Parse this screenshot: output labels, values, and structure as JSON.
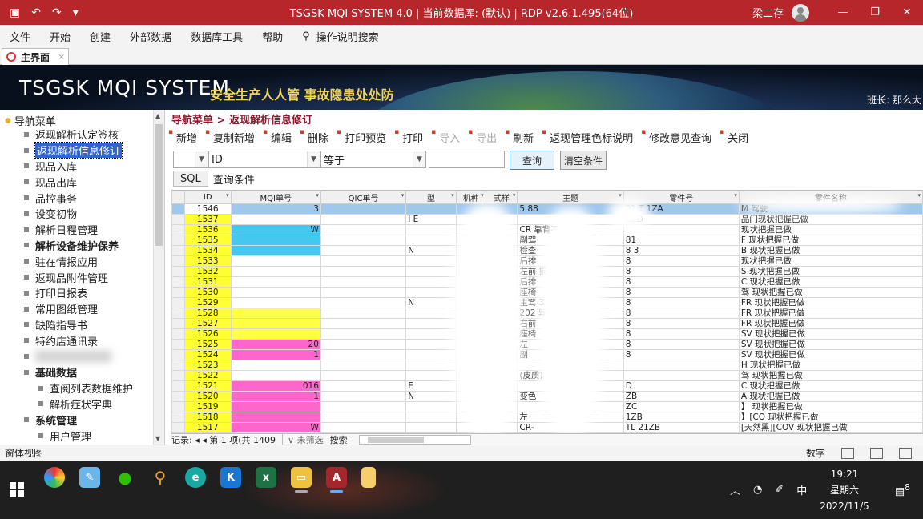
{
  "titlebar": {
    "title": "TSGSK MQI SYSTEM 4.0 | 当前数据库: (默认) | RDP v2.6.1.495(64位)",
    "user": "梁二存",
    "minimize": "—",
    "restore": "❐",
    "close": "✕"
  },
  "menu": {
    "items": [
      "文件",
      "开始",
      "创建",
      "外部数据",
      "数据库工具",
      "帮助"
    ],
    "search_label": "操作说明搜索"
  },
  "doc_tab": {
    "label": "主界面",
    "close": "×"
  },
  "banner": {
    "system_name": "TSGSK MQI SYSTEM",
    "slogan": "安全生产人人管 事故隐患处处防",
    "leader": "班长: 那么大"
  },
  "nav": {
    "title": "导航菜单",
    "items": [
      {
        "label": "返现解析认定签核"
      },
      {
        "label": "返现解析信息修订",
        "selected": true
      },
      {
        "label": "现品入库"
      },
      {
        "label": "现品出库"
      },
      {
        "label": "品控事务"
      },
      {
        "label": "设变初物"
      },
      {
        "label": "解析日程管理"
      },
      {
        "label": "解析设备维护保养",
        "bold": true
      },
      {
        "label": "驻在情报应用"
      },
      {
        "label": "返现品附件管理"
      },
      {
        "label": "打印日报表"
      },
      {
        "label": "常用图纸管理"
      },
      {
        "label": "缺陷指导书"
      },
      {
        "label": "特约店通讯录"
      },
      {
        "label": "",
        "blurred": true
      },
      {
        "label": "基础数据",
        "bold": true
      },
      {
        "label": "查阅列表数据维护",
        "level": 2
      },
      {
        "label": "解析症状字典",
        "level": 2
      },
      {
        "label": "系统管理",
        "bold": true
      },
      {
        "label": "用户管理",
        "level": 2
      }
    ]
  },
  "breadcrumb": {
    "root": "导航菜单",
    "sep": " > ",
    "page": "返现解析信息修订"
  },
  "toolbar": {
    "buttons": [
      {
        "label": "新增"
      },
      {
        "label": "复制新增"
      },
      {
        "label": "编辑"
      },
      {
        "label": "删除"
      },
      {
        "label": "打印预览"
      },
      {
        "label": "打印"
      },
      {
        "label": "导入",
        "disabled": true
      },
      {
        "label": "导出",
        "disabled": true
      },
      {
        "label": "刷新"
      },
      {
        "label": "返现管理色标说明"
      },
      {
        "label": "修改意见查询"
      },
      {
        "label": "关闭"
      }
    ]
  },
  "filter": {
    "field_value": "ID",
    "operator_value": "等于",
    "value": "",
    "query_button": "查询",
    "clear_button": "清空条件"
  },
  "sql": {
    "button": "SQL",
    "label": "查询条件"
  },
  "grid": {
    "columns": [
      "ID",
      "MQI单号",
      "QIC单号",
      "型",
      "机种",
      "式样",
      "主题",
      "零件号",
      "零件名称"
    ],
    "rows": [
      {
        "id": "1546",
        "mqi": "3",
        "mqi_color": "none",
        "model": "",
        "theme": "5  88",
        "part": "21-T  1ZA",
        "name": "M 驾驶",
        "first": true
      },
      {
        "id": "1537",
        "mqi": "",
        "mqi_color": "none",
        "model": "I  E",
        "theme": "",
        "part": "SZD",
        "name": "品门现状把握已做"
      },
      {
        "id": "1536",
        "mqi": "W",
        "mqi_color": "c",
        "model": "",
        "theme": "CR  靠背不良",
        "part": "",
        "name": "现状把握已做"
      },
      {
        "id": "1535",
        "mqi": "",
        "mqi_color": "c",
        "model": "",
        "theme": "副驾",
        "part": "81",
        "name": "F  现状把握已做"
      },
      {
        "id": "1534",
        "mqi": "",
        "mqi_color": "c",
        "model": "N",
        "theme": "检查",
        "part": "8  3",
        "name": "B  现状把握已做"
      },
      {
        "id": "1533",
        "mqi": "",
        "mqi_color": "none",
        "model": "",
        "theme": "后排",
        "part": "8",
        "name": "现状把握已做"
      },
      {
        "id": "1532",
        "mqi": "",
        "mqi_color": "none",
        "model": "",
        "theme": "左前  损坏",
        "part": "8",
        "name": "S  现状把握已做"
      },
      {
        "id": "1531",
        "mqi": "",
        "mqi_color": "none",
        "model": "",
        "theme": "后排",
        "part": "8",
        "name": "C  现状把握已做"
      },
      {
        "id": "1530",
        "mqi": "",
        "mqi_color": "none",
        "model": "",
        "theme": "座椅",
        "part": "8",
        "name": "驾  现状把握已做"
      },
      {
        "id": "1529",
        "mqi": "",
        "mqi_color": "none",
        "model": "N",
        "theme": "主驾  3",
        "part": "8",
        "name": "FR  现状把握已做"
      },
      {
        "id": "1528",
        "mqi": "",
        "mqi_color": "y",
        "model": "",
        "theme": "202  异响",
        "part": "8",
        "name": "FR  现状把握已做"
      },
      {
        "id": "1527",
        "mqi": "",
        "mqi_color": "y",
        "model": "",
        "theme": "右前",
        "part": "8",
        "name": "FR  现状把握已做"
      },
      {
        "id": "1526",
        "mqi": "",
        "mqi_color": "y",
        "model": "",
        "theme": "座椅",
        "part": "8",
        "name": "SV  现状把握已做"
      },
      {
        "id": "1525",
        "mqi": "20",
        "mqi_color": "p",
        "model": "",
        "theme": "左",
        "part": "8",
        "name": "SV  现状把握已做"
      },
      {
        "id": "1524",
        "mqi": "1",
        "mqi_color": "p",
        "model": "",
        "theme": "副",
        "part": "8",
        "name": "SV  现状把握已做"
      },
      {
        "id": "1523",
        "mqi": "",
        "mqi_color": "none",
        "model": "",
        "theme": "",
        "part": "",
        "name": "H  现状把握已做"
      },
      {
        "id": "1522",
        "mqi": "",
        "mqi_color": "none",
        "model": "",
        "theme": "(皮质)",
        "part": "",
        "name": "驾  现状把握已做"
      },
      {
        "id": "1521",
        "mqi": "016",
        "mqi_color": "p",
        "model": "E",
        "theme": "",
        "part": "D",
        "name": "C  现状把握已做"
      },
      {
        "id": "1520",
        "mqi": "1",
        "mqi_color": "p",
        "model": "N",
        "theme": "变色",
        "part": "ZB",
        "name": "A  现状把握已做"
      },
      {
        "id": "1519",
        "mqi": "",
        "mqi_color": "p",
        "model": "",
        "theme": "",
        "part": "ZC",
        "name": "】  现状把握已做"
      },
      {
        "id": "1518",
        "mqi": "",
        "mqi_color": "p",
        "model": "",
        "theme": "左",
        "part": "1ZB",
        "name": "】[CO  现状把握已做"
      },
      {
        "id": "1517",
        "mqi": "W",
        "mqi_color": "p",
        "model": "",
        "theme": "CR-",
        "part": "TL  21ZB",
        "name": "[天然黑][COV  现状把握已做"
      }
    ]
  },
  "recnav": {
    "record_label": "记录: ◂  ◂ 第 1 项(共 1409",
    "no_filter": "未筛选",
    "search": "搜索"
  },
  "status": {
    "left": "窗体视图",
    "mode": "数字"
  },
  "taskbar": {
    "ime": "中",
    "time": "19:21",
    "weekday": "星期六",
    "date": "2022/11/5",
    "notif": "8",
    "icons": [
      "chrome-icon",
      "paint-icon",
      "wechat-icon",
      "search-app-icon",
      "edge-icon",
      "k-app-icon",
      "excel-icon",
      "explorer-icon",
      "access-icon",
      "notes-icon"
    ]
  }
}
